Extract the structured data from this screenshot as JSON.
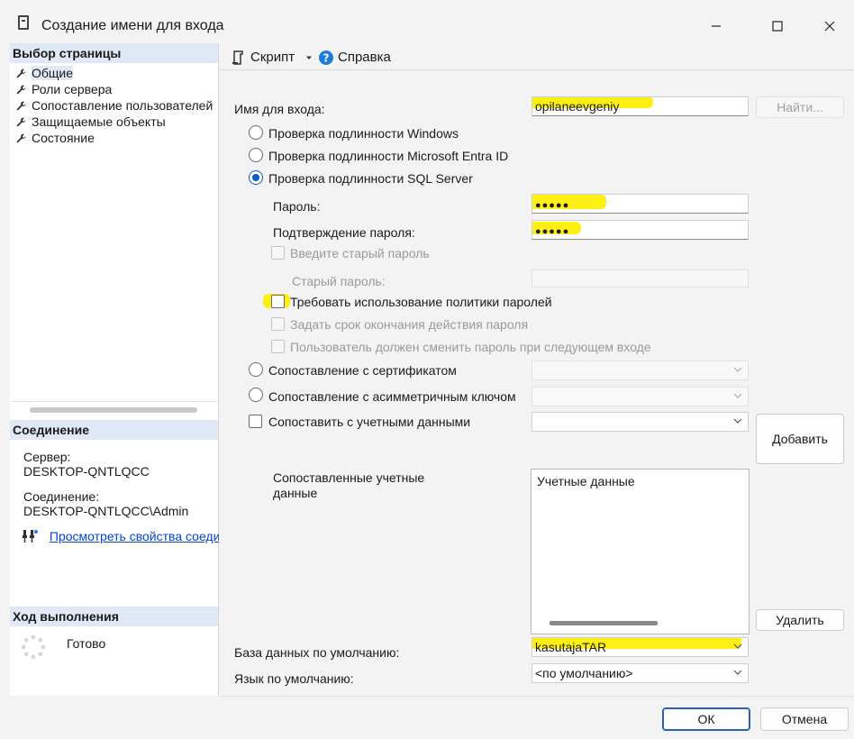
{
  "window": {
    "title": "Создание имени для входа",
    "minimize_icon": "minimize-icon",
    "maximize_icon": "maximize-icon",
    "close_icon": "close-icon"
  },
  "sidebar": {
    "pages_header": "Выбор страницы",
    "items": [
      {
        "label": "Общие",
        "icon": "wrench-icon"
      },
      {
        "label": "Роли сервера",
        "icon": "wrench-icon"
      },
      {
        "label": "Сопоставление пользователей",
        "icon": "wrench-icon"
      },
      {
        "label": "Защищаемые объекты",
        "icon": "wrench-icon"
      },
      {
        "label": "Состояние",
        "icon": "wrench-icon"
      }
    ],
    "connection_header": "Соединение",
    "server_label": "Сервер:",
    "server_value": "DESKTOP-QNTLQCC",
    "connection_label": "Соединение:",
    "connection_value": "DESKTOP-QNTLQCC\\Admin",
    "view_link": "Просмотреть свойства соединения",
    "progress_header": "Ход выполнения",
    "progress_status": "Готово"
  },
  "toolbar": {
    "script_label": "Скрипт",
    "help_label": "Справка"
  },
  "form": {
    "login_label": "Имя для входа:",
    "login_value": "opilaneevgeniy",
    "find_button": "Найти...",
    "auth_windows": "Проверка подлинности Windows",
    "auth_entra": "Проверка подлинности Microsoft Entra ID",
    "auth_sql": "Проверка подлинности SQL Server",
    "password_label": "Пароль:",
    "password_value": "●●●●●",
    "confirm_label": "Подтверждение пароля:",
    "confirm_value": "●●●●●",
    "old_password_check": "Введите старый пароль",
    "old_password_label": "Старый пароль:",
    "enforce_policy": "Требовать использование политики паролей",
    "enforce_expiration": "Задать срок окончания действия пароля",
    "must_change": "Пользователь должен сменить пароль при следующем входе",
    "map_certificate": "Сопоставление с сертификатом",
    "map_asym_key": "Сопоставление с асимметричным ключом",
    "map_credential": "Сопоставить с учетными данными",
    "add_button": "Добавить",
    "mapped_credentials_label": "Сопоставленные учетные данные",
    "credentials_column": "Учетные данные",
    "remove_button": "Удалить",
    "default_db_label": "База данных по умолчанию:",
    "default_db_value": "kasutajaTAR",
    "default_lang_label": "Язык по умолчанию:",
    "default_lang_value": "<по умолчанию>"
  },
  "footer": {
    "ok_button": "ОК",
    "cancel_button": "Отмена"
  },
  "colors": {
    "highlight": "#ffef00",
    "accent": "#0a5bd3",
    "link": "#0645c8"
  }
}
